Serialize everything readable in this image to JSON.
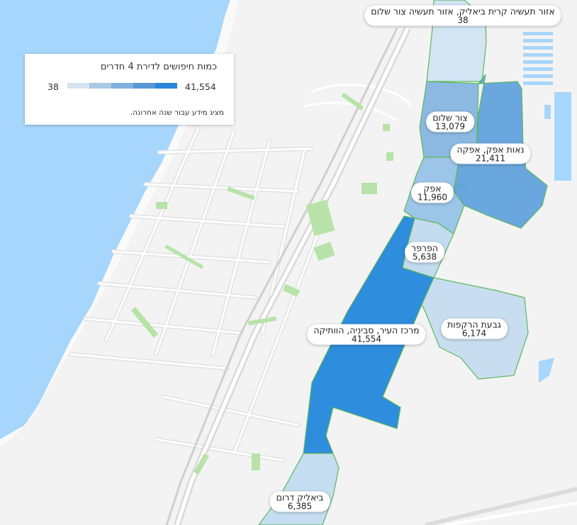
{
  "legend": {
    "title": "כמות חיפושים לדירת 4 חדרים",
    "min": "38",
    "max": "41,554",
    "note": "מציג מידע עבור שנה אחרונה.",
    "scale_colors": [
      "#d4e4f0",
      "#a9c8e2",
      "#7fb0dc",
      "#5698d6",
      "#2b85d8"
    ]
  },
  "neighborhoods": [
    {
      "name": "אזור תעשיה קרית ביאליק, אזור תעשיה צור שלום",
      "value": "38",
      "fill": "#cfe2f3"
    },
    {
      "name": "צור שלום",
      "value": "13,079",
      "fill": "#7fb3e0"
    },
    {
      "name": "נאות אפק, אפקה",
      "value": "21,411",
      "fill": "#5a9fdc"
    },
    {
      "name": "אפק",
      "value": "11,960",
      "fill": "#92c0e6"
    },
    {
      "name": "הפרפר",
      "value": "5,638",
      "fill": "#bdd8ee"
    },
    {
      "name": "מרכז העיר, סביניה, הוותיקה",
      "value": "41,554",
      "fill": "#2e8ddc"
    },
    {
      "name": "גבעת הרקפות",
      "value": "6,174",
      "fill": "#c3dcef"
    },
    {
      "name": "ביאליק דרום",
      "value": "6,385",
      "fill": "#c0daf0"
    }
  ],
  "colors": {
    "sea": "#a7d6fc",
    "land": "#f3f3f3",
    "road": "#ffffff",
    "park": "#b7e3a8",
    "border": "#5cb85c"
  }
}
